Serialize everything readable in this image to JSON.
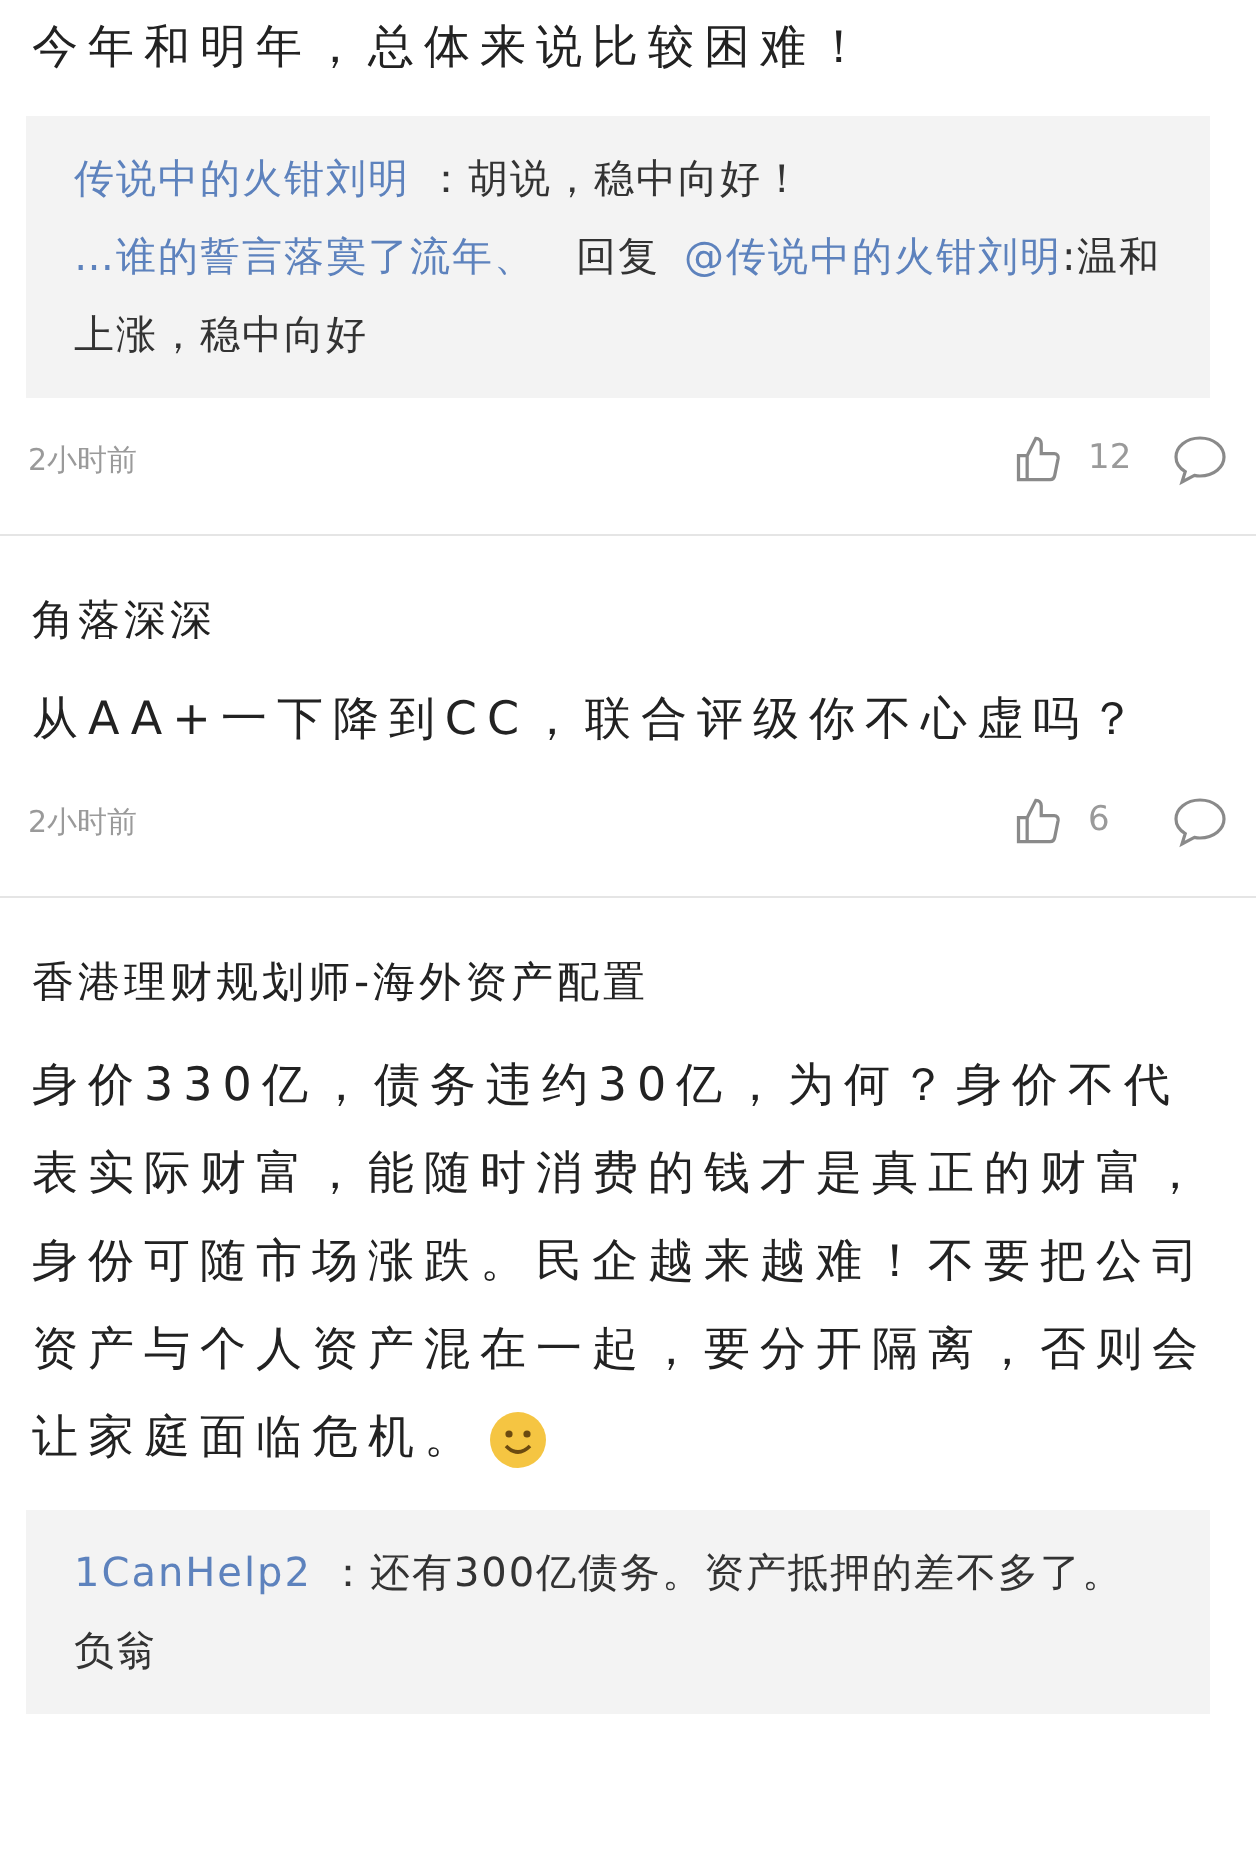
{
  "comments": [
    {
      "text": "今年和明年，总体来说比较困难！",
      "emoji": false,
      "replies": [
        {
          "author": "传说中的火钳刘明",
          "text": "：胡说，稳中向好！"
        },
        {
          "author": "…谁的誓言落寞了流年、",
          "reply_label": "回复",
          "target": "@传说中的火钳刘明",
          "text": ":温和上涨，稳中向好"
        }
      ],
      "time": "2小时前",
      "likes": "12"
    },
    {
      "author": "角落深深",
      "text": "从AA+一下降到CC，联合评级你不心虚吗？",
      "emoji": false,
      "time": "2小时前",
      "likes": "6"
    },
    {
      "author": "香港理财规划师-海外资产配置",
      "text": "身价330亿，债务违约30亿，为何？身价不代表实际财富，能随时消费的钱才是真正的财富，身份可随市场涨跌。民企越来越难！不要把公司资产与个人资产混在一起，要分开隔离，否则会让家庭面临危机。",
      "emoji": true,
      "replies": [
        {
          "author": "1CanHelp2",
          "text": "：还有300亿债务。资产抵押的差不多了。负翁"
        }
      ]
    }
  ]
}
